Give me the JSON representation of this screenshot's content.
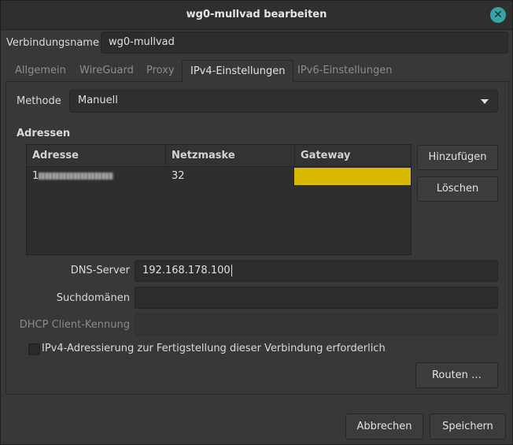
{
  "window": {
    "title": "wg0-mullvad bearbeiten"
  },
  "connection": {
    "name_label": "Verbindungsname",
    "name_value": "wg0-mullvad"
  },
  "tabs": [
    {
      "label": "Allgemein",
      "active": false
    },
    {
      "label": "WireGuard",
      "active": false
    },
    {
      "label": "Proxy",
      "active": false
    },
    {
      "label": "IPv4-Einstellungen",
      "active": true
    },
    {
      "label": "IPv6-Einstellungen",
      "active": false
    }
  ],
  "method": {
    "label": "Methode",
    "value": "Manuell"
  },
  "addresses": {
    "heading": "Adressen",
    "columns": [
      "Adresse",
      "Netzmaske",
      "Gateway"
    ],
    "rows": [
      {
        "address": "1",
        "netmask": "32",
        "gateway": ""
      }
    ],
    "add_label": "Hinzufügen",
    "delete_label": "Löschen"
  },
  "dns": {
    "label": "DNS-Server",
    "value": "192.168.178.100"
  },
  "search_domains": {
    "label": "Suchdomänen",
    "value": ""
  },
  "dhcp_client_id": {
    "label": "DHCP Client-Kennung",
    "value": ""
  },
  "require_ipv4": {
    "label": "IPv4-Adressierung zur Fertigstellung dieser Verbindung erforderlich",
    "checked": false
  },
  "routes_label": "Routen …",
  "footer": {
    "cancel_label": "Abbrechen",
    "save_label": "Speichern"
  },
  "colors": {
    "gateway_highlight": "#d9b800",
    "accent_close": "#35a4a6"
  }
}
